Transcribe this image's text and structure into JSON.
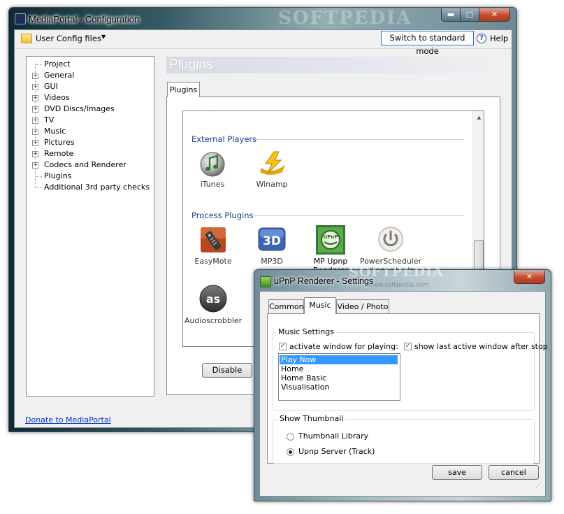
{
  "main_window": {
    "title": "MediaPortal - Configuration",
    "watermark": "SOFTPEDIA",
    "controls": {
      "minimize": "▬",
      "maximize": "▢",
      "close": "✕"
    },
    "toolbar": {
      "config_label": "User Config files",
      "dropdown_arrow": "▼",
      "switch_mode": "Switch to standard mode",
      "help_glyph": "?",
      "help": "Help"
    },
    "tree": [
      {
        "label": "Project",
        "expandable": false
      },
      {
        "label": "General",
        "expandable": true
      },
      {
        "label": "GUI",
        "expandable": true
      },
      {
        "label": "Videos",
        "expandable": true
      },
      {
        "label": "DVD Discs/Images",
        "expandable": true
      },
      {
        "label": "TV",
        "expandable": true
      },
      {
        "label": "Music",
        "expandable": true
      },
      {
        "label": "Pictures",
        "expandable": true
      },
      {
        "label": "Remote",
        "expandable": true
      },
      {
        "label": "Codecs and Renderer",
        "expandable": true
      },
      {
        "label": "Plugins",
        "expandable": false
      },
      {
        "label": "Additional 3rd party checks",
        "expandable": false
      }
    ],
    "expand_glyph": "+",
    "donate_link": "Donate to MediaPortal",
    "section_header": "Plugins",
    "tab": "Plugins",
    "groups": {
      "external": {
        "title": "External Players",
        "items": [
          {
            "label": "iTunes",
            "icon": "itunes-icon"
          },
          {
            "label": "Winamp",
            "icon": "winamp-icon"
          }
        ]
      },
      "process": {
        "title": "Process Plugins",
        "items": [
          {
            "label": "EasyMote",
            "icon": "easymote-icon"
          },
          {
            "label": "MP3D",
            "icon": "mp3d-icon"
          },
          {
            "label": "MP Upnp\nRenderer",
            "icon": "upnp-icon"
          },
          {
            "label": "PowerScheduler\nclient plugin",
            "icon": "power-icon"
          },
          {
            "label": "Audioscrobbler",
            "icon": "lastfm-icon"
          }
        ]
      }
    },
    "disable_button": "Disable",
    "scroll_up_glyph": "▲"
  },
  "dialog": {
    "title": "uPnP Renderer - Settings",
    "watermark": "SOFTPEDIA",
    "watermark_url": "www.softpedia.com",
    "close_glyph": "✕",
    "tabs": [
      "Common",
      "Music",
      "Video / Photo"
    ],
    "active_tab": "Music",
    "music_settings": {
      "legend": "Music Settings",
      "activate_window_label": "activate window for playing:",
      "activate_window_checked": true,
      "show_last_label": "show last active window after stop",
      "show_last_checked": true,
      "check_glyph": "✓",
      "window_options": [
        "Play Now",
        "Home",
        "Home Basic",
        "Visualisation"
      ],
      "selected_option": "Play Now"
    },
    "thumbnail": {
      "legend": "Show Thumbnail",
      "options": [
        "Thumbnail Library",
        "Upnp Server (Track)"
      ],
      "selected": "Upnp Server (Track)"
    },
    "save_button": "save",
    "cancel_button": "cancel",
    "grip_glyph": "⋰"
  }
}
